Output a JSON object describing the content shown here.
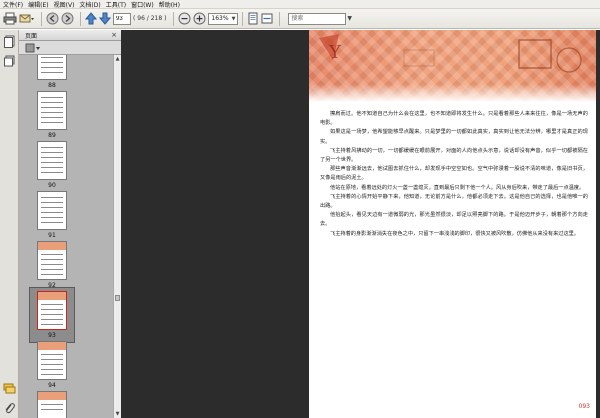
{
  "menubar": {
    "items": [
      "文件(F)",
      "编辑(E)",
      "视图(V)",
      "文档(D)",
      "工具(T)",
      "窗口(W)",
      "帮助(H)"
    ]
  },
  "toolbar": {
    "page_input": "93",
    "page_total": "( 96 / 218 )",
    "zoom": "163%",
    "search_placeholder": "搜索"
  },
  "panel": {
    "title": "页面",
    "close_glyph": "×"
  },
  "thumbnails": [
    {
      "label": "88",
      "selected": false,
      "style": "text"
    },
    {
      "label": "89",
      "selected": false,
      "style": "text"
    },
    {
      "label": "90",
      "selected": false,
      "style": "text"
    },
    {
      "label": "91",
      "selected": false,
      "style": "text"
    },
    {
      "label": "92",
      "selected": false,
      "style": "orange"
    },
    {
      "label": "93",
      "selected": true,
      "style": "orange"
    },
    {
      "label": "94",
      "selected": false,
      "style": "orange"
    }
  ],
  "page": {
    "paragraphs": [
      "擦肩而过。他不知道自己为什么会在这里，也不知道即将发生什么。只是看着那些人来来往往，像是一场无声的电影。",
      "如果这是一场梦，他希望能够早点醒来。只是梦里的一切都如此真实，真实到让他无法分辨，哪里才是真正的现实。",
      "飞主持着风拂动的一切，一切都缓缓在眼前展开，对面的人向他点头示意，说话却没有声音，似乎一切都被隔在了另一个世界。",
      "那些声音渐渐远去，他试图去抓住什么，却发现手中空空如也。空气中弥漫着一股说不清的味道，像是旧书页，又像是雨后的泥土。",
      "他站在原地，看着远处的灯火一盏一盏熄灭，直到最后只剩下他一个人。风从身后吹来，带走了最后一点温度。",
      "飞主持着的心情开始平静下来，他知道，无论前方是什么，他都必须走下去。这是他自己的选择，也是他唯一的出路。",
      "他抬起头，看见天边有一道微弱的光，那光虽然很淡，却足以照亮脚下的路。于是他迈开步子，朝着那个方向走去。",
      "飞主持着的身影渐渐消失在夜色之中，只留下一串浅浅的脚印，很快又被风吹散，仿佛他从来没有来过这里。"
    ],
    "page_number": "093"
  }
}
